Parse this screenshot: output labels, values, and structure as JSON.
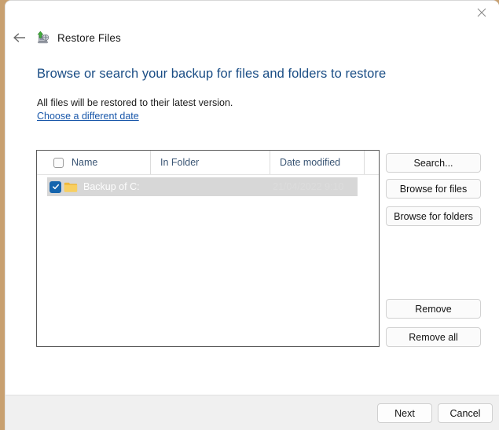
{
  "window": {
    "title": "Restore Files",
    "close_label": "✕",
    "back_label": "←",
    "app_icon": "restore-files-icon"
  },
  "page": {
    "heading": "Browse or search your backup for files and folders to restore",
    "subtitle": "All files will be restored to their latest version.",
    "date_link": "Choose a different date"
  },
  "list": {
    "columns": [
      "Name",
      "In Folder",
      "Date modified"
    ],
    "header_checkbox_checked": false,
    "rows": [
      {
        "checked": true,
        "icon": "folder-icon",
        "name": "Backup of C:",
        "in_folder": "",
        "date_modified": "21/04/2022 9:10",
        "selected": true
      }
    ]
  },
  "side_buttons": [
    {
      "label": "Search...",
      "name": "search-button"
    },
    {
      "label": "Browse for files",
      "name": "browse-for-files-button"
    },
    {
      "label": "Browse for folders",
      "name": "browse-for-folders-button"
    },
    {
      "label": "Remove",
      "name": "remove-button"
    },
    {
      "label": "Remove all",
      "name": "remove-all-button"
    }
  ],
  "footer": {
    "next_label": "Next",
    "cancel_label": "Cancel"
  },
  "colors": {
    "heading_blue": "#1a4d85",
    "link_blue": "#1756a9",
    "checkbox_blue": "#1464ad",
    "folder_yellow": "#f5c344",
    "selection_gray": "#d7d7d7",
    "bottom_bar": "#f0f0f0",
    "list_border": "#595959"
  }
}
